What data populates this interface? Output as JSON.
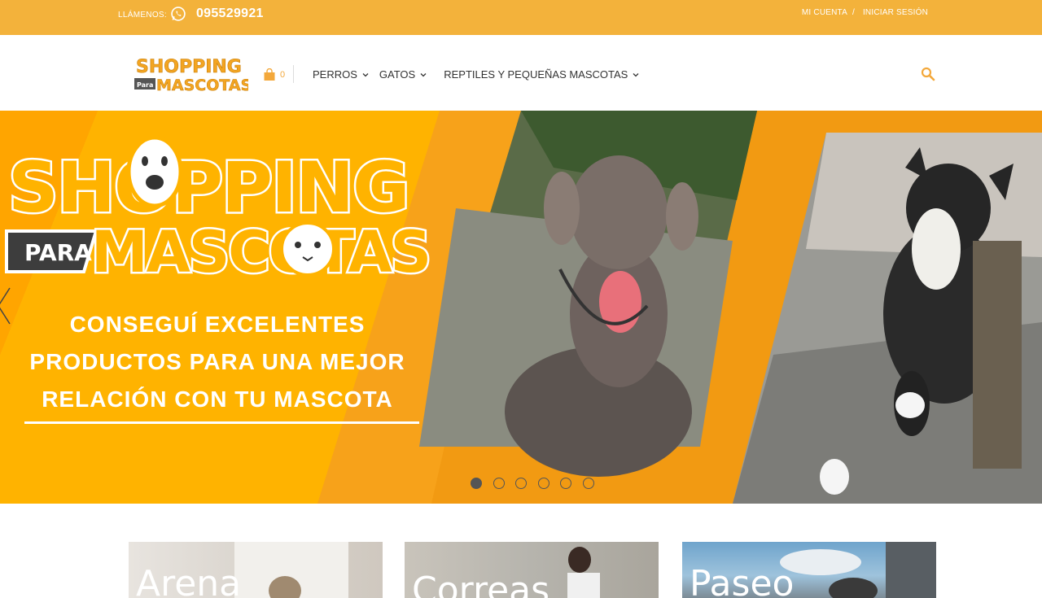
{
  "topbar": {
    "call_label": "LLÁMENOS:",
    "phone": "095529921",
    "account": "MI CUENTA",
    "separator": "/",
    "login": "INICIAR SESIÓN"
  },
  "header": {
    "logo_text_top": "SHOPPING",
    "logo_text_para": "Para",
    "logo_text_bottom": "MASCOTAS",
    "cart_count": "0",
    "nav": [
      {
        "label": "PERROS"
      },
      {
        "label": "GATOS"
      },
      {
        "label": "REPTILES Y PEQUEÑAS MASCOTAS"
      }
    ]
  },
  "hero": {
    "brand_top": "SHOPPING",
    "brand_para": "PARA",
    "brand_bottom": "MASCOTAS",
    "slogan_lines": [
      "CONSEGUÍ EXCELENTES",
      "PRODUCTOS PARA UNA MEJOR",
      "RELACIÓN CON TU MASCOTA"
    ],
    "slides": 6,
    "active_slide": 1
  },
  "categories": [
    {
      "label": "Arena"
    },
    {
      "label": "Correas"
    },
    {
      "label": "Paseo"
    }
  ],
  "colors": {
    "topbar": "#f3b23b",
    "accent": "#f3a83b",
    "hero_orange": "#f29a12",
    "hero_light": "#ffb300"
  }
}
